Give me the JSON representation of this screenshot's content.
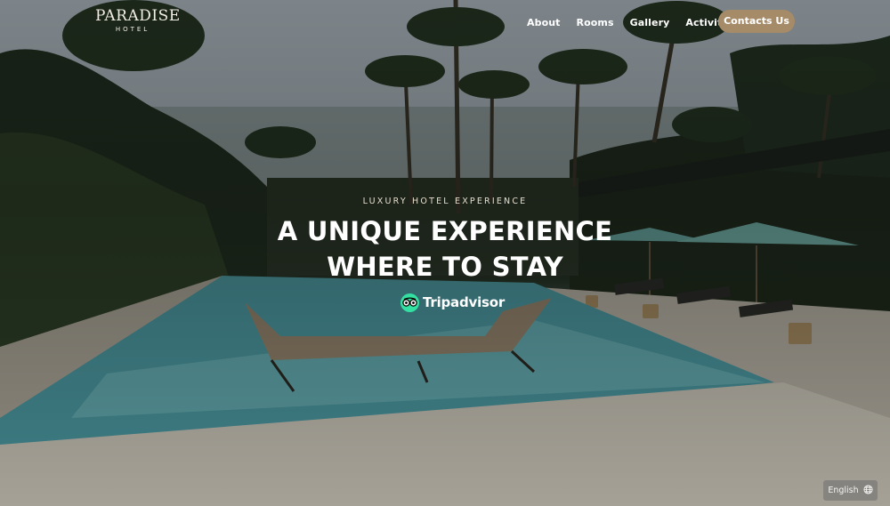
{
  "header": {
    "brand": "PARADISE",
    "brand_sub": "HOTEL",
    "nav": [
      "About",
      "Rooms",
      "Gallery",
      "Activities"
    ],
    "contact_label": "Contacts Us"
  },
  "hero": {
    "eyebrow": "LUXURY HOTEL EXPERIENCE",
    "headline_line1": "A UNIQUE EXPERIENCE",
    "headline_line2": "WHERE TO STAY",
    "tripadvisor": "Tripadvisor"
  },
  "footer": {
    "language": "English",
    "language_icon": "globe-icon"
  },
  "colors": {
    "accent": "#a68b68",
    "tripadvisor_green": "#34e0a1"
  }
}
